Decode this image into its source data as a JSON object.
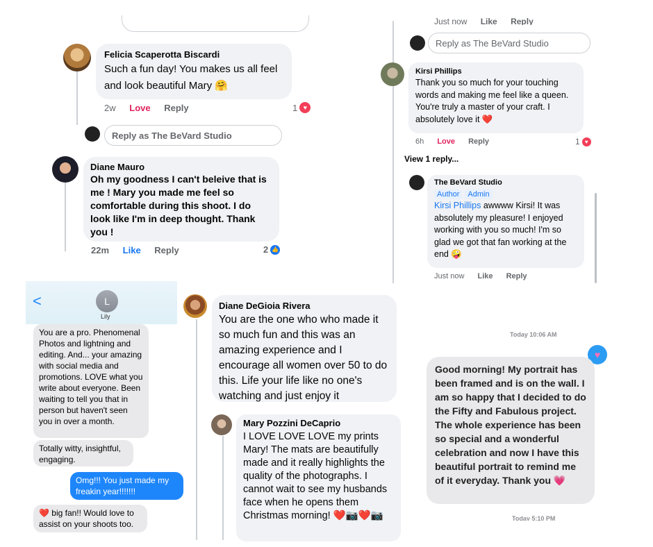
{
  "top_left": {
    "felicia": {
      "name": "Felicia Scaperotta Biscardi",
      "text": "Such a fun day! You makes us all feel and look beautiful Mary 🤗",
      "time": "2w",
      "love": "Love",
      "reply": "Reply",
      "count": "1"
    },
    "reply_as": "Reply as The BeVard Studio",
    "diane": {
      "name": "Diane Mauro",
      "text": "Oh my goodness I can't beleive that is me ! Mary you made me feel so comfortable during this shoot.  I do look like I'm in deep thought. Thank you !",
      "time": "22m",
      "like": "Like",
      "reply": "Reply",
      "count": "2"
    }
  },
  "top_right": {
    "top_meta": {
      "time": "Just now",
      "like": "Like",
      "reply": "Reply"
    },
    "reply_as": "Reply as The BeVard Studio",
    "kirsi": {
      "name": "Kirsi Phillips",
      "text": "Thank you so much for your touching words and making me feel like a queen. You're truly a master of your craft. I absolutely love it ❤️",
      "time": "6h",
      "love": "Love",
      "reply": "Reply",
      "count": "1"
    },
    "view_replies": "View 1 reply...",
    "studio": {
      "name": "The BeVard Studio",
      "tags": [
        "Author",
        "Admin"
      ],
      "mention": "Kirsi Phillips",
      "text": " awwww Kirsi! It was absolutely my pleasure! I enjoyed working with you so much! I'm so glad we got that fan working at the end 🤪",
      "time": "Just now",
      "like": "Like",
      "reply": "Reply"
    }
  },
  "imessage": {
    "contact_initial": "L",
    "contact_name": "Lily",
    "back": "<",
    "messages": [
      {
        "from": "them",
        "text": "You are a pro. Phenomenal Photos and lightning and editing. And... your amazing with social media and promotions. LOVE what you write about everyone. Been waiting to tell you that in person but haven't seen you in over a month."
      },
      {
        "from": "them",
        "text": "Totally witty, insightful, engaging."
      },
      {
        "from": "me",
        "text": "Omg!!! You just made my freakin year!!!!!!!"
      },
      {
        "from": "them",
        "text": "❤️ big fan!! Would love to assist on your shoots too."
      }
    ]
  },
  "middle": {
    "diane_d": {
      "name": "Diane DeGioia Rivera",
      "text": "You are the one who who made it so much fun and this was an amazing experience and I encourage all women over 50 to do this. Life your life like no one's watching and just enjoy it"
    },
    "mary": {
      "name": "Mary Pozzini DeCaprio",
      "text": "I LOVE LOVE LOVE my prints Mary!  The mats are beautifully made and it really highlights the quality of the photographs.  I cannot wait to see my husbands face when he opens them Christmas morning!  ❤️📷❤️📷"
    }
  },
  "right_sms": {
    "timestamp": "Today 10:06 AM",
    "message": "Good morning! My portrait has been framed and is on the wall. I am so happy that I decided to do the Fifty and Fabulous project. The whole experience has been so special and a wonderful celebration and now I have this beautiful portrait to remind me of it everyday. Thank you 💗",
    "bottom_timestamp": "Today 5:10 PM"
  },
  "colors": {
    "accent": "#1877f2",
    "love": "#e0245e",
    "imessage_blue": "#1e86fb",
    "bubble": "#f0f2f5"
  }
}
